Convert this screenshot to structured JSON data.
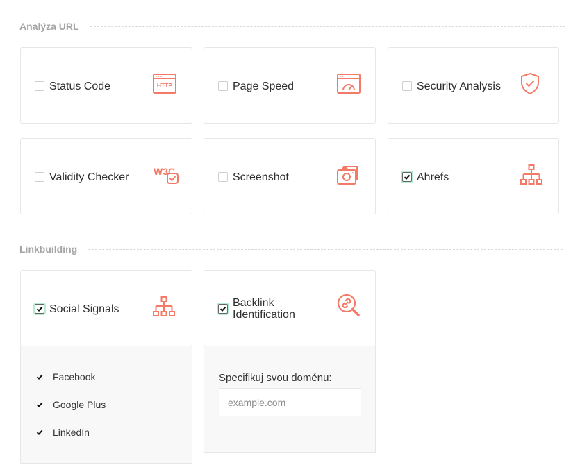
{
  "sections": {
    "analyza": {
      "title": "Analýza URL"
    },
    "linkbuilding": {
      "title": "Linkbuilding"
    }
  },
  "cards": {
    "status_code": {
      "label": "Status Code",
      "checked": false,
      "icon": "http-browser-icon"
    },
    "page_speed": {
      "label": "Page Speed",
      "checked": false,
      "icon": "speedometer-browser-icon"
    },
    "security": {
      "label": "Security Analysis",
      "checked": false,
      "icon": "shield-check-icon"
    },
    "validity": {
      "label": "Validity Checker",
      "checked": false,
      "icon": "w3c-check-icon"
    },
    "screenshot": {
      "label": "Screenshot",
      "checked": false,
      "icon": "camera-icon"
    },
    "ahrefs": {
      "label": "Ahrefs",
      "checked": true,
      "icon": "sitemap-icon"
    },
    "social": {
      "label": "Social Signals",
      "checked": true,
      "icon": "sitemap-icon"
    },
    "backlink": {
      "label_line1": "Backlink",
      "label_line2": "Identification",
      "checked": true,
      "icon": "link-search-icon"
    }
  },
  "social_options": [
    {
      "label": "Facebook",
      "checked": true
    },
    {
      "label": "Google Plus",
      "checked": true
    },
    {
      "label": "LinkedIn",
      "checked": true
    }
  ],
  "domain": {
    "label": "Specifikuj svou doménu:",
    "placeholder": "example.com",
    "value": ""
  },
  "colors": {
    "accent": "#f47a67",
    "check_glow": "#b6ecd2"
  }
}
